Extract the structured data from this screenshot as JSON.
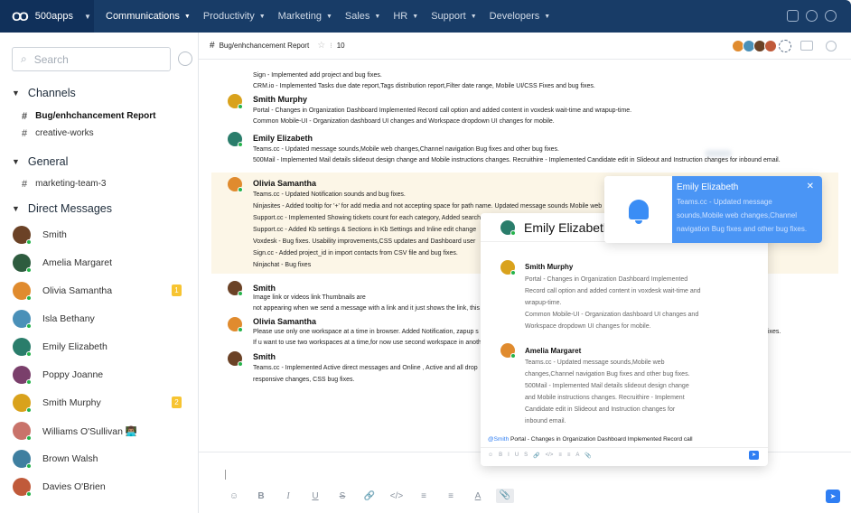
{
  "topbar": {
    "brand": "500apps",
    "nav": [
      "Communications",
      "Productivity",
      "Marketing",
      "Sales",
      "HR",
      "Support",
      "Developers"
    ],
    "active": "Communications"
  },
  "sidebar": {
    "search_placeholder": "Search",
    "channels_title": "Channels",
    "channels": [
      "Bug/enhchancement Report",
      "creative-works"
    ],
    "general_title": "General",
    "general": [
      "marketing-team-3"
    ],
    "dm_title": "Direct Messages",
    "dms": [
      {
        "name": "Smith",
        "color": "#6b4226",
        "badge": ""
      },
      {
        "name": "Amelia Margaret",
        "color": "#2e5c3f",
        "badge": ""
      },
      {
        "name": "Olivia Samantha",
        "color": "#e08b2e",
        "badge": "1"
      },
      {
        "name": "Isla Bethany",
        "color": "#4a90b8",
        "badge": ""
      },
      {
        "name": "Emily Elizabeth",
        "color": "#2a7d6b",
        "badge": ""
      },
      {
        "name": "Poppy Joanne",
        "color": "#7a3f6b",
        "badge": ""
      },
      {
        "name": "Smith Murphy",
        "color": "#d9a21c",
        "badge": "2"
      },
      {
        "name": "Williams O'Sullivan 👨🏽‍💻",
        "color": "#c9736a",
        "badge": ""
      },
      {
        "name": "Brown Walsh",
        "color": "#3f7fa0",
        "badge": ""
      },
      {
        "name": "Davies O'Brien",
        "color": "#c05a3a",
        "badge": ""
      }
    ]
  },
  "channel_header": {
    "name": "Bug/enhchancement Report",
    "members": "10"
  },
  "messages": {
    "top_lines": [
      "Sign - Implemented add project and bug fixes.",
      "CRM.io - Implemented Tasks due date report,Tags distribution report,Filter date range, Mobile UI/CSS Fixes and bug fixes."
    ],
    "m1_sender": "Smith Murphy",
    "m1_lines": [
      "Portal - Changes in Organization Dashboard Implemented Record call option and added content in voxdesk wait-time and wrapup-time.",
      "Common Mobile-UI - Organization dashboard UI changes and Workspace dropdown UI changes for mobile."
    ],
    "m2_sender": "Emily Elizabeth",
    "m2_lines": [
      "Teams.cc - Updated message sounds,Mobile web changes,Channel navigation Bug fixes and other bug fixes.",
      "500Mail - Implemented Mail details slideout design change and Mobile instructions changes. Recruithire - Implemented Candidate edit in Slideout and Instruction changes for inbound email."
    ],
    "m3_sender": "Olivia Samantha",
    "m3_lines": [
      "Teams.cc - Updated Notification sounds and bug fixes.",
      "Ninjasites - Added tooltip for '+' for add media and not accepting space for path name. Updated message sounds Mobile web",
      "Support.cc - Implemented Showing tickets count for each category, Added search",
      "Support.cc - Added Kb settings & Sections in Kb Settings and Inline edit change",
      "Voxdesk - Bug fixes. Usability improvements,CSS updates and Dashboard user",
      "Sign.cc - Added project_id in import contacts from CSV file and bug fixes.",
      "Ninjachat - Bug fixes"
    ],
    "m4_sender": "Smith",
    "m4_lines": [
      "Image link or videos link Thumbnails are",
      "not appearing when we send a message with a link and it just shows the link, this"
    ],
    "m5_sender": "Olivia Samantha",
    "m5_lines": [
      "Please use only one workspace at a time in browser. Added Notification, zapup s",
      "If u want to use two workspaces at a time,for now use second workspace in anoth"
    ],
    "m5_tail": "fixes.",
    "m6_sender": "Smith",
    "m6_lines": [
      "Teams.cc - Implemented Active direct messages and Online , Active and all drop",
      "responsive changes, CSS bug fixes."
    ]
  },
  "popup": {
    "title": "Emily Elizabeth",
    "p1_sender": "Smith Murphy",
    "p1_lines": [
      "Portal - Changes in Organization Dashboard Implemented",
      "Record call option and added content in voxdesk wait-time and",
      "wrapup-time.",
      "Common Mobile-UI - Organization dashboard UI changes and",
      "Workspace dropdown UI changes for mobile."
    ],
    "p2_sender": "Amelia Margaret",
    "p2_lines": [
      "Teams.cc - Updated message sounds,Mobile web",
      "changes,Channel navigation Bug fixes and other bug fixes.",
      "500Mail - Implemented Mail details slideout design change",
      "and Mobile instructions changes. Recruithire - Implement",
      "Candidate edit in Slideout and Instruction changes for",
      "inbound email."
    ],
    "mention": "@Smith",
    "footer": " Portal - Changes in Organization Dashboard Implemented Record call"
  },
  "notification": {
    "title": "Emily Elizabeth",
    "text": "Teams.cc - Updated message\nsounds,Mobile web changes,Channel\nnavigation Bug fixes and other bug fixes."
  },
  "composer_tools": [
    "☺",
    "B",
    "I",
    "U",
    "S",
    "🔗",
    "</>",
    "≡",
    "≡",
    "A",
    "📎"
  ]
}
